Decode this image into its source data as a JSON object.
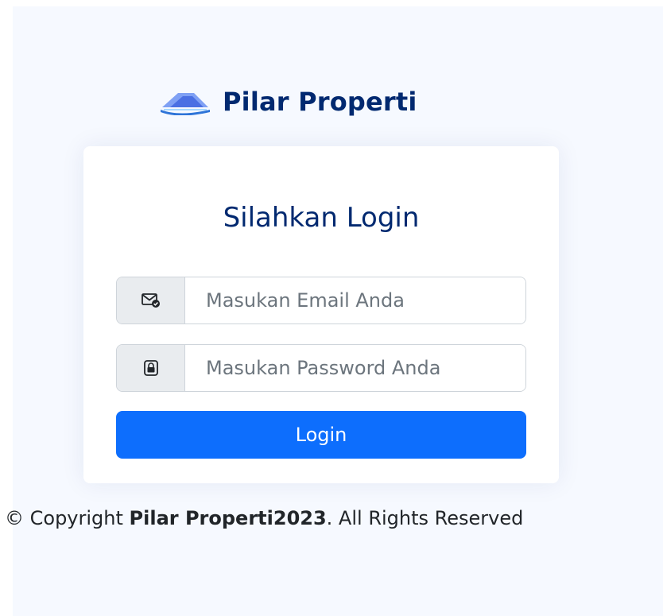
{
  "brand": {
    "name": "Pilar Properti",
    "logo_icon": "house-roof-logo-icon",
    "colors": {
      "text": "#012970",
      "logo_primary": "#4154f1",
      "logo_secondary": "#2eca6a"
    }
  },
  "login": {
    "title": "Silahkan Login",
    "email": {
      "icon": "envelope-check-icon",
      "placeholder": "Masukan Email Anda",
      "value": ""
    },
    "password": {
      "icon": "lock-icon",
      "placeholder": "Masukan Password Anda",
      "value": ""
    },
    "submit_label": "Login"
  },
  "footer": {
    "prefix": "© Copyright ",
    "brand_year": "Pilar Properti2023",
    "suffix": ". All Rights Reserved"
  },
  "colors": {
    "background": "#f6f9ff",
    "primary_button": "#0d6efd",
    "input_border": "#ced4da",
    "addon_background": "#e9ecef"
  }
}
